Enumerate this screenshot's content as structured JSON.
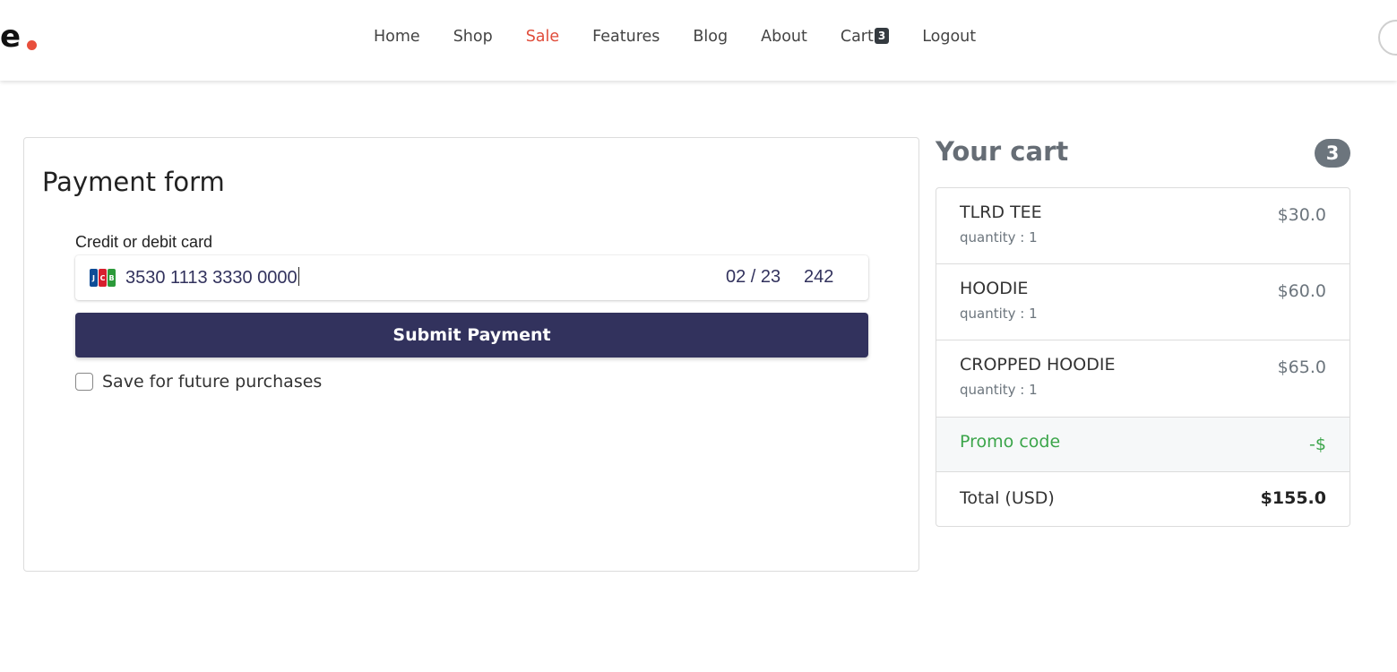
{
  "header": {
    "logo_text": "e",
    "nav": [
      {
        "label": "Home"
      },
      {
        "label": "Shop"
      },
      {
        "label": "Sale"
      },
      {
        "label": "Features"
      },
      {
        "label": "Blog"
      },
      {
        "label": "About"
      },
      {
        "label": "Cart",
        "badge": "3"
      },
      {
        "label": "Logout"
      }
    ]
  },
  "payment": {
    "title": "Payment form",
    "card_label": "Credit or debit card",
    "card_brand_icon": "jcb-card-icon",
    "card_number": "3530 1113 3330 0000",
    "expiry": "02 / 23",
    "cvc": "242",
    "submit_label": "Submit Payment",
    "save_label": "Save for future purchases",
    "save_checked": false
  },
  "cart": {
    "title": "Your cart",
    "count": "3",
    "items": [
      {
        "name": "TLRD TEE",
        "qty": "quantity : 1",
        "price": "$30.0"
      },
      {
        "name": "HOODIE",
        "qty": "quantity : 1",
        "price": "$60.0"
      },
      {
        "name": "CROPPED HOODIE",
        "qty": "quantity : 1",
        "price": "$65.0"
      }
    ],
    "promo_label": "Promo code",
    "promo_value": "-$",
    "total_label": "Total (USD)",
    "total_value": "$155.0"
  },
  "colors": {
    "brand_accent": "#e84f3c",
    "sale_link": "#e04d3b",
    "submit_button": "#32325d",
    "promo_green": "#3ba54a",
    "badge_gray": "#6c757d"
  }
}
